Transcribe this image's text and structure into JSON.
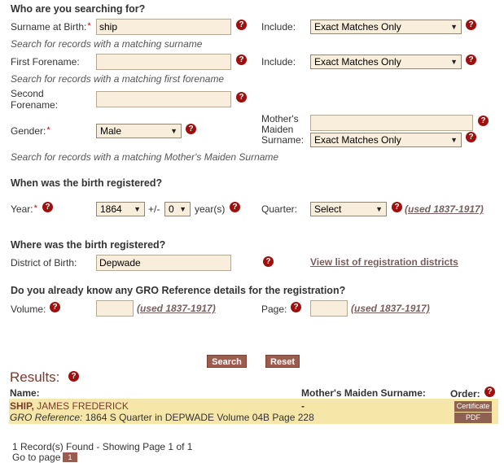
{
  "search": {
    "heading": "Who are you searching for?",
    "surname_label": "Surname at Birth:",
    "surname_value": "ship",
    "include_label": "Include:",
    "surname_include": "Exact Matches Only",
    "surname_hint": "Search for records with a matching surname",
    "forename1_label": "First Forename:",
    "forename1_value": "",
    "forename1_include": "Exact Matches Only",
    "forename1_hint": "Search for records with a matching first forename",
    "forename2_label_line1": "Second",
    "forename2_label_line2": "Forename:",
    "forename2_value": "",
    "gender_label": "Gender:",
    "gender_value": "Male",
    "mmn_label_line1": "Mother's",
    "mmn_label_line2": "Maiden",
    "mmn_label_line3": "Surname:",
    "mmn_value": "",
    "mmn_include": "Exact Matches Only",
    "mmn_hint": "Search for records with a matching Mother's Maiden Surname"
  },
  "when": {
    "heading": "When was the birth registered?",
    "year_label": "Year:",
    "year_value": "1864",
    "plusminus": "+/-",
    "range_value": "0",
    "years_text": "year(s)",
    "quarter_label": "Quarter:",
    "quarter_value": "Select",
    "used_note": "(used 1837-1917)"
  },
  "where": {
    "heading": "Where was the birth registered?",
    "district_label": "District of Birth:",
    "district_value": "Depwade",
    "districts_link": "View list of registration districts"
  },
  "gro": {
    "heading": "Do you already know any GRO Reference details for the registration?",
    "volume_label": "Volume:",
    "volume_value": "",
    "page_label": "Page:",
    "page_value": "",
    "used_note": "(used 1837-1917)"
  },
  "buttons": {
    "search": "Search",
    "reset": "Reset"
  },
  "results": {
    "title": "Results:",
    "col_name": "Name:",
    "col_mmn": "Mother's Maiden Surname:",
    "col_order": "Order:",
    "rows": [
      {
        "surname": "SHIP,",
        "forenames": "JAMES  FREDERICK",
        "mmn": "-",
        "gro_label": "GRO Reference:",
        "gro_text": "1864  S Quarter in DEPWADE  Volume 04B  Page 228",
        "cert_label": "Certificate",
        "pdf_label": "PDF"
      }
    ],
    "found_text": "1 Record(s) Found - Showing Page 1 of 1",
    "goto_label": "Go to page",
    "page_number": "1"
  },
  "colors": {
    "input_bg": "#f8eedb",
    "help_icon": "#a10e0e",
    "button": "#9b5b4d",
    "result_row": "#f6e7a9",
    "link": "#7a5d5d"
  },
  "icons": {
    "help": "question-circle-icon",
    "dropdown": "chevron-down-icon"
  }
}
